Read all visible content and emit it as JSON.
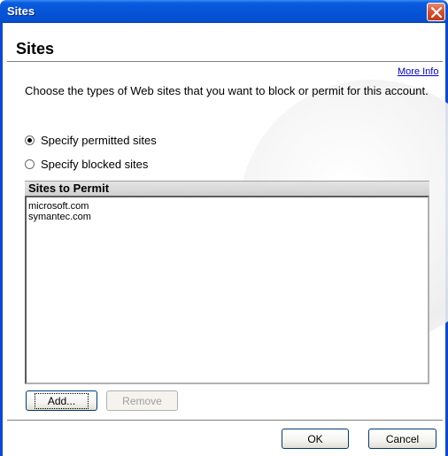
{
  "window": {
    "title": "Sites"
  },
  "header": {
    "heading": "Sites",
    "more_info": "More Info"
  },
  "description": "Choose the types of Web sites that you want to block or permit for this account.",
  "options": [
    {
      "label": "Specify permitted sites",
      "selected": true
    },
    {
      "label": "Specify blocked sites",
      "selected": false
    }
  ],
  "list": {
    "header": "Sites to Permit",
    "items": [
      "microsoft.com",
      "symantec.com"
    ]
  },
  "buttons": {
    "add": "Add...",
    "remove": "Remove",
    "ok": "OK",
    "cancel": "Cancel"
  },
  "colors": {
    "titlebar": "#0654d8",
    "link": "#0000cc",
    "close": "#d6502c"
  },
  "icons": {
    "close": "close-icon"
  }
}
